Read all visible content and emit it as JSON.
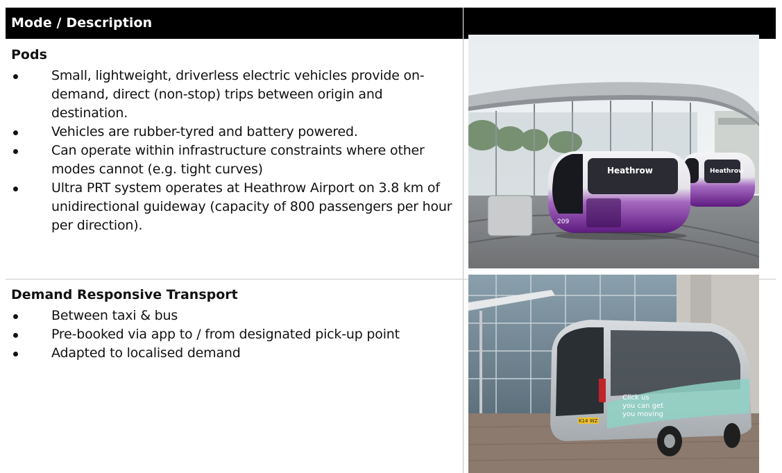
{
  "table": {
    "header": {
      "mode_label": "Mode / Description"
    },
    "rows": [
      {
        "title": "Pods",
        "bullets": [
          "Small, lightweight, driverless electric vehicles provide on-demand, direct (non-stop) trips between origin and destination.",
          "Vehicles are rubber-tyred and battery powered.",
          "Can operate within infrastructure constraints where other modes cannot (e.g. tight curves)",
          "Ultra PRT system operates at Heathrow Airport on 3.8 km of unidirectional guideway (capacity of 800 passengers per hour per direction)."
        ],
        "photo": {
          "brand_text": "Heathrow",
          "vehicle_number": "209"
        }
      },
      {
        "title": "Demand Responsive Transport",
        "bullets": [
          "Between taxi & bus",
          "Pre-booked via app to / from designated pick-up point",
          "Adapted to localised demand"
        ],
        "photo": {
          "livery_text": "Click us\nyou can get\nyou moving",
          "plate_text": "K14 WZ"
        }
      }
    ]
  },
  "colors": {
    "header_bg": "#000000",
    "header_text": "#ffffff",
    "pod_purple": "#7a2a9a",
    "grid_line": "#c0c0c0"
  }
}
